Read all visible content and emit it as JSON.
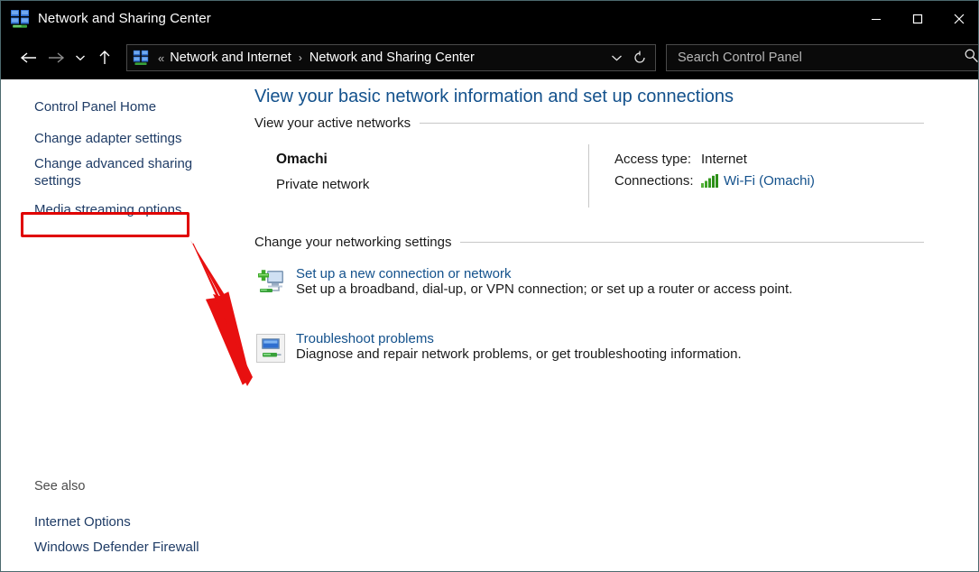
{
  "window": {
    "title": "Network and Sharing Center",
    "title_icon": "network-computers-icon",
    "controls": {
      "minimize": "Minimize",
      "maximize": "Maximize",
      "close": "Close"
    }
  },
  "navbar": {
    "back": "Back",
    "forward": "Forward",
    "recent": "Recent locations",
    "up": "Up one level",
    "address_icon": "network-computers-icon",
    "overflow_chevron": "«",
    "breadcrumbs": [
      "Network and Internet",
      "Network and Sharing Center"
    ],
    "breadcrumb_separator": "›",
    "dropdown": "Previous locations",
    "refresh": "Refresh",
    "search": {
      "value": "",
      "placeholder": "Search Control Panel",
      "icon": "search-icon"
    }
  },
  "sidebar": {
    "items": [
      {
        "label": "Control Panel Home"
      },
      {
        "label": "Change adapter settings"
      },
      {
        "label": "Change advanced sharing settings"
      },
      {
        "label": "Media streaming options"
      }
    ],
    "see_also": {
      "label": "See also",
      "items": [
        {
          "label": "Internet Options"
        },
        {
          "label": "Windows Defender Firewall"
        }
      ]
    }
  },
  "annotation": {
    "highlight_target": "Change adapter settings",
    "box_color": "#e00000",
    "arrow_color": "#e00000"
  },
  "main": {
    "page_title": "View your basic network information and set up connections",
    "active_networks": {
      "heading": "View your active networks",
      "network": {
        "name": "Omachi",
        "type": "Private network",
        "access_type_label": "Access type:",
        "access_type_value": "Internet",
        "connections_label": "Connections:",
        "connections_value": "Wi-Fi (Omachi)",
        "connections_icon": "wifi-signal-bars-icon"
      }
    },
    "change_settings": {
      "heading": "Change your networking settings",
      "tasks": [
        {
          "icon": "new-connection-icon",
          "link": "Set up a new connection or network",
          "description": "Set up a broadband, dial-up, or VPN connection; or set up a router or access point."
        },
        {
          "icon": "troubleshoot-icon",
          "link": "Troubleshoot problems",
          "description": "Diagnose and repair network problems, or get troubleshooting information."
        }
      ]
    }
  },
  "colors": {
    "link": "#13518c",
    "titlebar_bg": "#000000",
    "accent_red": "#e00000",
    "signal_green": "#3a9b1f"
  }
}
